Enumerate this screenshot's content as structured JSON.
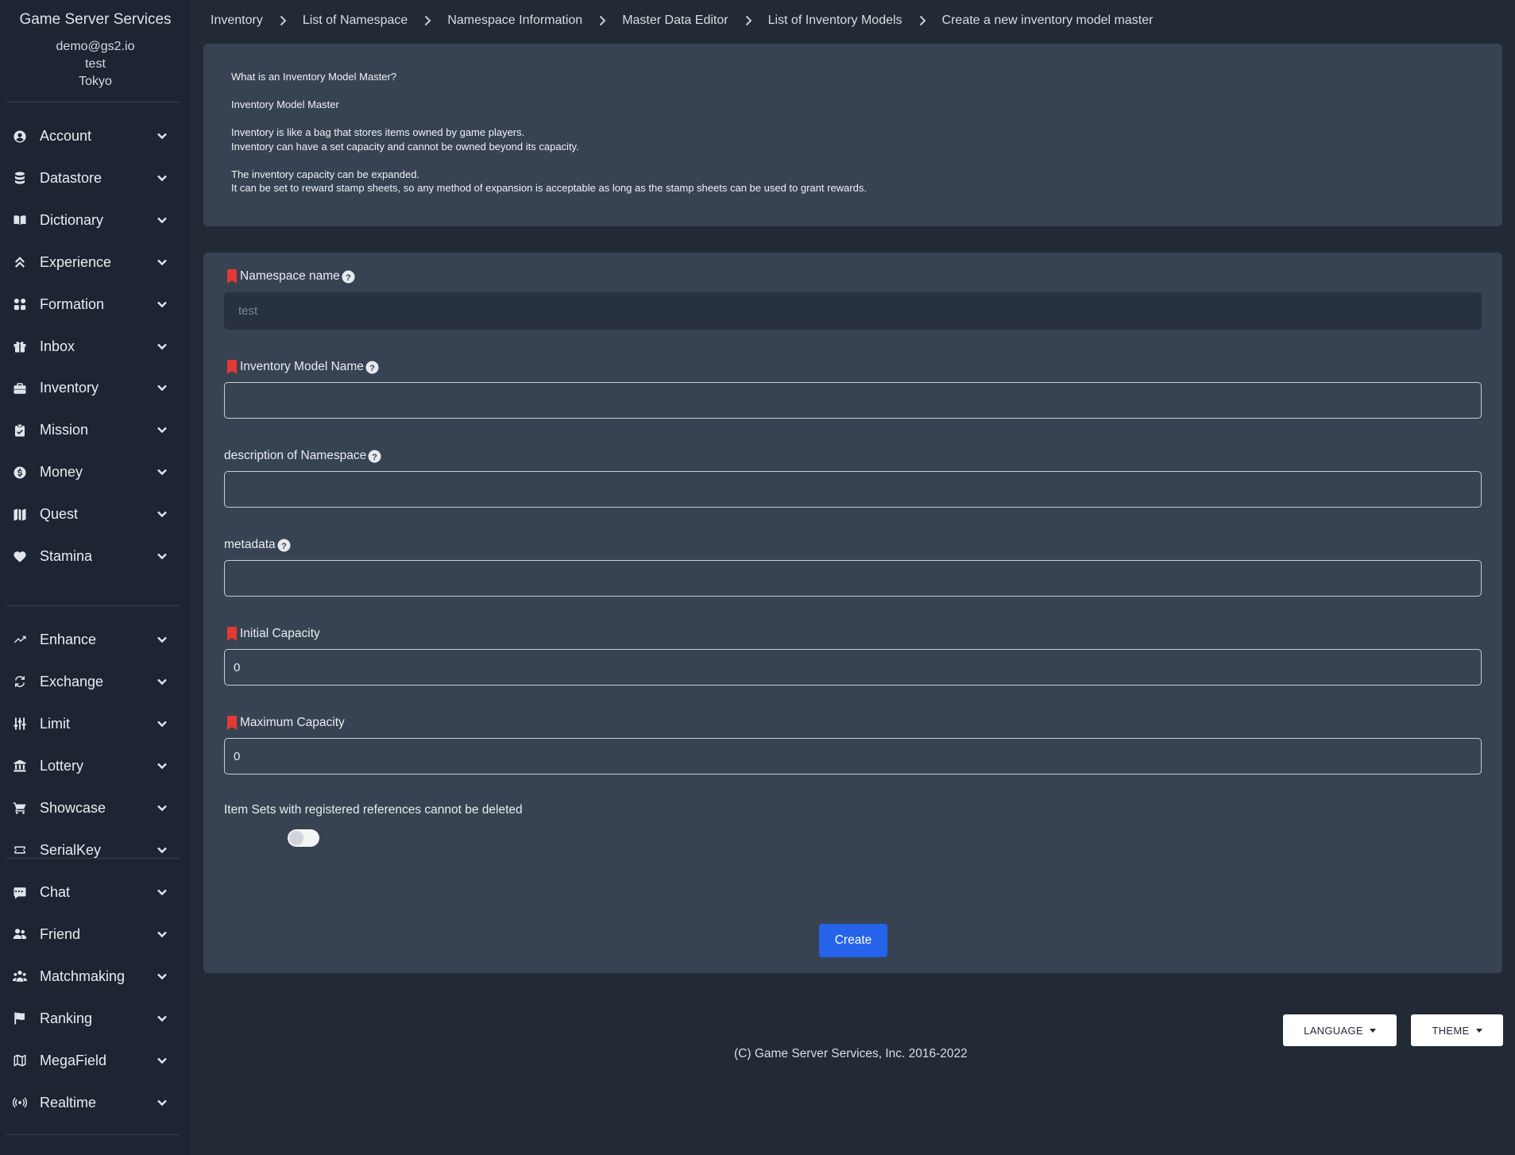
{
  "sidebar": {
    "app_title": "Game Server Services",
    "user_email": "demo@gs2.io",
    "user_project": "test",
    "user_region": "Tokyo",
    "groups": [
      [
        {
          "label": "Account",
          "icon": "user-circle-icon"
        },
        {
          "label": "Datastore",
          "icon": "database-icon"
        },
        {
          "label": "Dictionary",
          "icon": "book-open-icon"
        },
        {
          "label": "Experience",
          "icon": "double-chevron-up-icon"
        },
        {
          "label": "Formation",
          "icon": "grid-icon"
        },
        {
          "label": "Inbox",
          "icon": "gift-icon"
        },
        {
          "label": "Inventory",
          "icon": "briefcase-icon"
        },
        {
          "label": "Mission",
          "icon": "clipboard-check-icon"
        },
        {
          "label": "Money",
          "icon": "dollar-circle-icon"
        },
        {
          "label": "Quest",
          "icon": "map-icon"
        },
        {
          "label": "Stamina",
          "icon": "heart-icon"
        }
      ],
      [
        {
          "label": "Enhance",
          "icon": "trending-up-icon"
        },
        {
          "label": "Exchange",
          "icon": "exchange-icon"
        },
        {
          "label": "Limit",
          "icon": "sliders-icon"
        },
        {
          "label": "Lottery",
          "icon": "bank-icon"
        },
        {
          "label": "Showcase",
          "icon": "cart-icon"
        },
        {
          "label": "SerialKey",
          "icon": "ticket-icon"
        }
      ],
      [
        {
          "label": "Chat",
          "icon": "chat-icon"
        },
        {
          "label": "Friend",
          "icon": "users-icon"
        },
        {
          "label": "Matchmaking",
          "icon": "user-group-icon"
        },
        {
          "label": "Ranking",
          "icon": "flag-icon"
        },
        {
          "label": "MegaField",
          "icon": "map-outline-icon"
        },
        {
          "label": "Realtime",
          "icon": "broadcast-icon"
        }
      ]
    ]
  },
  "breadcrumb": [
    "Inventory",
    "List of Namespace",
    "Namespace Information",
    "Master Data Editor",
    "List of Inventory Models",
    "Create a new inventory model master"
  ],
  "info": {
    "lines": [
      "What is an Inventory Model Master?",
      "",
      "Inventory Model Master",
      "",
      "Inventory is like a bag that stores items owned by game players.",
      "Inventory can have a set capacity and cannot be owned beyond its capacity.",
      "",
      "The inventory capacity can be expanded.",
      "It can be set to reward stamp sheets, so any method of expansion is acceptable as long as the stamp sheets can be used to grant rewards."
    ]
  },
  "form": {
    "namespace_name": {
      "label": "Namespace name",
      "placeholder": "test",
      "required": true
    },
    "model_name": {
      "label": "Inventory Model Name",
      "value": "",
      "required": true
    },
    "description": {
      "label": "description of Namespace",
      "value": ""
    },
    "metadata": {
      "label": "metadata",
      "value": ""
    },
    "initial_capacity": {
      "label": "Initial Capacity",
      "value": "0",
      "required": true
    },
    "max_capacity": {
      "label": "Maximum Capacity",
      "value": "0",
      "required": true
    },
    "protect_toggle": {
      "label": "Item Sets with registered references cannot be deleted",
      "checked": false
    },
    "submit_label": "Create"
  },
  "footer": {
    "language_label": "LANGUAGE",
    "theme_label": "THEME",
    "copyright": "(C) Game Server Services, Inc. 2016-2022"
  },
  "colors": {
    "sidebar_bg": "#1c2531",
    "page_bg": "#222a35",
    "card_bg": "#374352",
    "primary_button": "#2563eb",
    "required_marker": "#e53935"
  }
}
